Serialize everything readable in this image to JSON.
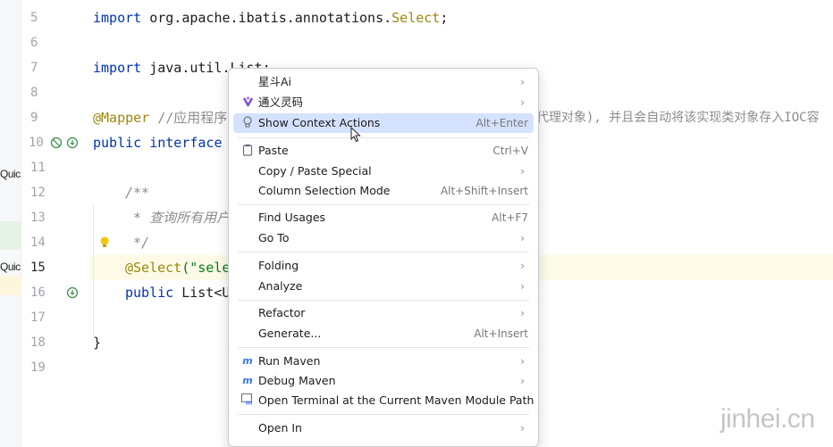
{
  "left_strip": {
    "label1": "Quic",
    "label2": "Quic"
  },
  "gutter": {
    "lines": [
      "5",
      "6",
      "7",
      "8",
      "9",
      "10",
      "11",
      "12",
      "13",
      "14",
      "15",
      "16",
      "17",
      "18",
      "19"
    ],
    "icons": {
      "line10_a": "no-entry-icon",
      "line10_b": "implementations-icon",
      "line14": "lightbulb-icon",
      "line16": "implementations-icon"
    }
  },
  "code": {
    "l5_kw": "import",
    "l5_rest": " org.apache.ibatis.annotations.",
    "l5_cls": "Select",
    "l5_end": ";",
    "l7_kw": "import",
    "l7_rest": " java.util.List;",
    "l9_ann": "@Mapper",
    "l9_cmt": " //应用程序",
    "l9_cmt_tail": "代理对象), 并且会自动将该实现类对象存入IOC容",
    "l10_kw1": "public",
    "l10_kw2": " interface",
    "l12": "/**",
    "l13": " * 查询所有用户",
    "l14": " */",
    "l15_ann": "@Select",
    "l15_rest": "(\"sele",
    "l16_kw": "public",
    "l16_rest": " List<U",
    "l18": "}"
  },
  "menu": {
    "items": [
      {
        "label": "星斗Ai",
        "icon": "",
        "shortcut": "",
        "submenu": true
      },
      {
        "label": "通义灵码",
        "icon": "tongyi-icon",
        "shortcut": "",
        "submenu": true
      },
      {
        "label": "Show Context Actions",
        "icon": "lightbulb-icon",
        "shortcut": "Alt+Enter",
        "submenu": false,
        "selected": true
      },
      {
        "label": "Paste",
        "icon": "clipboard-icon",
        "shortcut": "Ctrl+V",
        "submenu": false
      },
      {
        "label": "Copy / Paste Special",
        "icon": "",
        "shortcut": "",
        "submenu": true
      },
      {
        "label": "Column Selection Mode",
        "icon": "",
        "shortcut": "Alt+Shift+Insert",
        "submenu": false
      },
      {
        "label": "Find Usages",
        "icon": "",
        "shortcut": "Alt+F7",
        "submenu": false
      },
      {
        "label": "Go To",
        "icon": "",
        "shortcut": "",
        "submenu": true
      },
      {
        "label": "Folding",
        "icon": "",
        "shortcut": "",
        "submenu": true
      },
      {
        "label": "Analyze",
        "icon": "",
        "shortcut": "",
        "submenu": true
      },
      {
        "label": "Refactor",
        "icon": "",
        "shortcut": "",
        "submenu": true
      },
      {
        "label": "Generate...",
        "icon": "",
        "shortcut": "Alt+Insert",
        "submenu": false
      },
      {
        "label": "Run Maven",
        "icon": "maven-run-icon",
        "shortcut": "",
        "submenu": true
      },
      {
        "label": "Debug Maven",
        "icon": "maven-debug-icon",
        "shortcut": "",
        "submenu": true
      },
      {
        "label": "Open Terminal at the Current Maven Module Path",
        "icon": "terminal-icon",
        "shortcut": "",
        "submenu": false
      },
      {
        "label": "Open In",
        "icon": "",
        "shortcut": "",
        "submenu": true
      }
    ]
  },
  "watermark": "jinhei.cn",
  "colors": {
    "keyword": "#0033b3",
    "annotation": "#9e880d",
    "comment": "#8c8c8c",
    "selection": "#d4e2ff"
  }
}
